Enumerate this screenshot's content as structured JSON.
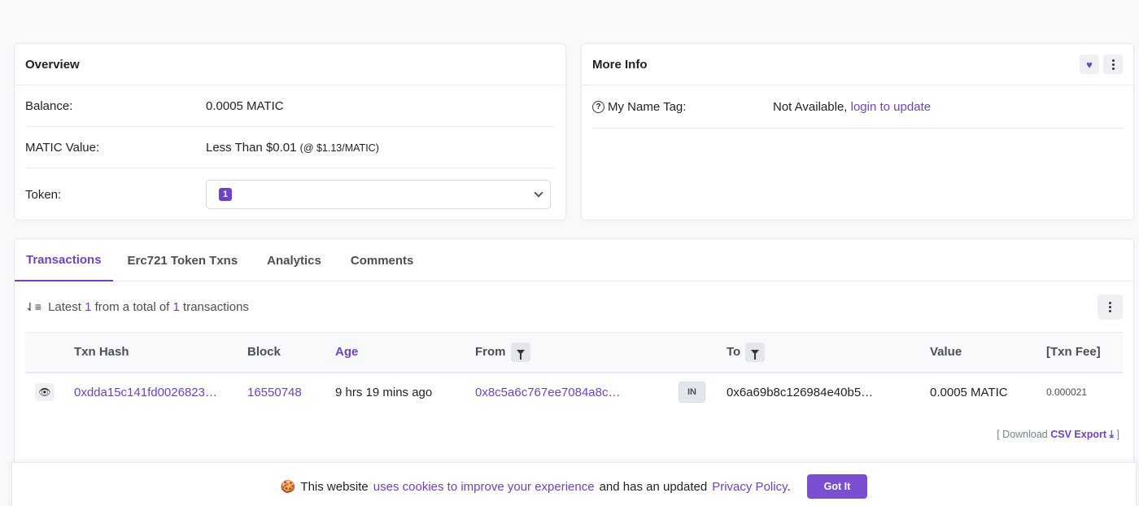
{
  "overview": {
    "title": "Overview",
    "balance_label": "Balance:",
    "balance_value": "0.0005 MATIC",
    "value_label": "MATIC Value:",
    "value_value": "Less Than $0.01",
    "value_rate": "(@ $1.13/MATIC)",
    "token_label": "Token:",
    "token_count": "1"
  },
  "more_info": {
    "title": "More Info",
    "name_tag_label": "My Name Tag:",
    "name_tag_value": "Not Available,",
    "name_tag_link": "login to update"
  },
  "tabs": [
    "Transactions",
    "Erc721 Token Txns",
    "Analytics",
    "Comments"
  ],
  "summary": {
    "prefix": "Latest",
    "count": "1",
    "middle": "from a total of",
    "total": "1",
    "suffix": "transactions"
  },
  "table": {
    "headers": {
      "hash": "Txn Hash",
      "block": "Block",
      "age": "Age",
      "from": "From",
      "to": "To",
      "value": "Value",
      "fee": "[Txn Fee]"
    },
    "rows": [
      {
        "hash": "0xdda15c141fd0026823…",
        "block": "16550748",
        "age": "9 hrs 19 mins ago",
        "from": "0x8c5a6c767ee7084a8c…",
        "direction": "IN",
        "to": "0x6a69b8c126984e40b5…",
        "value": "0.0005 MATIC",
        "fee": "0.000021"
      }
    ]
  },
  "download": {
    "open": "[ Download",
    "label": "CSV Export",
    "close": "]"
  },
  "cookie": {
    "text1": "This website",
    "link1": "uses cookies to improve your experience",
    "text2": "and has an updated",
    "link2": "Privacy Policy",
    "text3": ".",
    "button": "Got It"
  },
  "colors": {
    "accent": "#6f42c1",
    "button": "#7b4fd1"
  }
}
